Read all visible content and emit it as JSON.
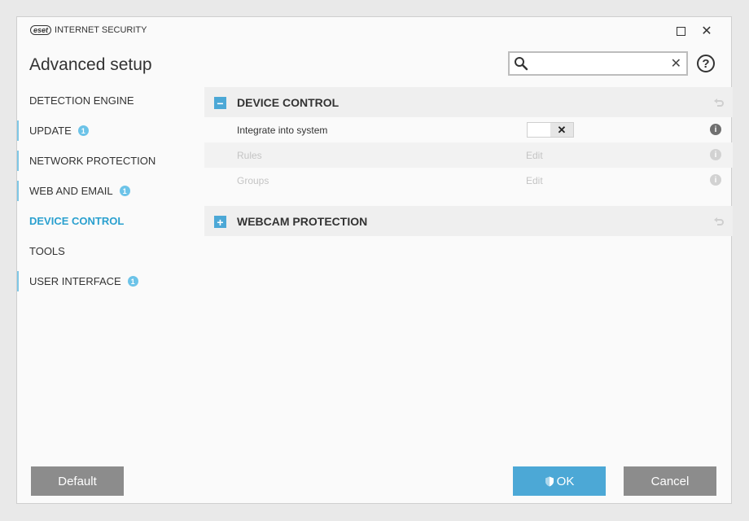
{
  "titlebar": {
    "logo_badge": "eset",
    "product_name": "INTERNET SECURITY",
    "maximize_icon": "maximize-icon",
    "close_symbol": "✕"
  },
  "header": {
    "title": "Advanced setup",
    "search_placeholder": "",
    "search_value": "",
    "search_clear": "✕",
    "help_symbol": "?"
  },
  "sidebar": {
    "items": [
      {
        "label": "DETECTION ENGINE",
        "badge": ""
      },
      {
        "label": "UPDATE",
        "badge": "1"
      },
      {
        "label": "NETWORK PROTECTION",
        "badge": ""
      },
      {
        "label": "WEB AND EMAIL",
        "badge": "1"
      },
      {
        "label": "DEVICE CONTROL",
        "badge": ""
      },
      {
        "label": "TOOLS",
        "badge": ""
      },
      {
        "label": "USER INTERFACE",
        "badge": "1"
      }
    ]
  },
  "sections": {
    "device_control": {
      "toggle": "−",
      "title": "DEVICE CONTROL",
      "rows": [
        {
          "label": "Integrate into system",
          "toggle_symbol": "✕",
          "info": "i"
        },
        {
          "label": "Rules",
          "edit": "Edit",
          "info": "i"
        },
        {
          "label": "Groups",
          "edit": "Edit",
          "info": "i"
        }
      ]
    },
    "webcam_protection": {
      "toggle": "+",
      "title": "WEBCAM PROTECTION"
    }
  },
  "footer": {
    "default_label": "Default",
    "ok_label": "OK",
    "cancel_label": "Cancel"
  },
  "colors": {
    "accent": "#4ca8d6",
    "active_nav": "#2aa0cf",
    "button_gray": "#8c8c8c",
    "badge": "#6cc3e8"
  }
}
